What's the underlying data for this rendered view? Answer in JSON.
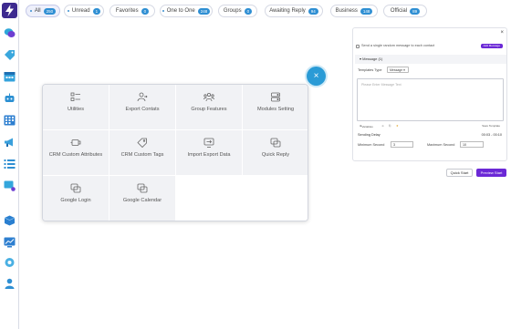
{
  "tabs": [
    {
      "label": "All",
      "badge": "250",
      "dot": true,
      "active": true
    },
    {
      "label": "Unread",
      "badge": "1",
      "dot": true,
      "active": false
    },
    {
      "label": "Favorites",
      "badge": "0",
      "dot": false,
      "active": false
    },
    {
      "label": "One to One",
      "badge": "248",
      "dot": true,
      "active": false
    },
    {
      "label": "Groups",
      "badge": "0",
      "dot": false,
      "active": false
    },
    {
      "label": "Awaiting Reply",
      "badge": "94",
      "dot": false,
      "active": false
    },
    {
      "label": "Business",
      "badge": "148",
      "dot": false,
      "active": false
    },
    {
      "label": "Official",
      "badge": "89",
      "dot": false,
      "active": false
    }
  ],
  "sidebar_icons": [
    "chat-icon",
    "tag-icon",
    "calendar-icon",
    "bot-icon",
    "grid-icon",
    "megaphone-icon",
    "list-icon",
    "media-icon",
    "box-icon",
    "chart-icon",
    "settings-icon",
    "user-icon"
  ],
  "menu": {
    "items": [
      {
        "label": "Utilities",
        "icon": "utilities-icon"
      },
      {
        "label": "Export Contats",
        "icon": "export-contacts-icon"
      },
      {
        "label": "Group Features",
        "icon": "group-features-icon"
      },
      {
        "label": "Modules Setting",
        "icon": "modules-setting-icon"
      },
      {
        "label": "CRM Custom Attributes",
        "icon": "crm-attributes-icon"
      },
      {
        "label": "CRM Custom Tags",
        "icon": "crm-tags-icon"
      },
      {
        "label": "Import Export Data",
        "icon": "import-export-icon"
      },
      {
        "label": "Quick Reply",
        "icon": "quick-reply-icon"
      },
      {
        "label": "Google Login",
        "icon": "google-login-icon"
      },
      {
        "label": "Google Calendar",
        "icon": "google-calendar-icon"
      }
    ],
    "close_symbol": "×"
  },
  "panel": {
    "close_symbol": "×",
    "random_label": "Send a single random message to each contact",
    "add_message_label": "Add Message",
    "message_title": "Message (1)",
    "template_type_label": "Templates Type",
    "template_type_value": "Message",
    "placeholder": "Please Enter Message Text",
    "toolbar": [
      "Variables",
      "Save Template"
    ],
    "sending_delay_label": "Sending Delay",
    "sending_delay_value": "00:03 - 00:10",
    "min_label": "Minimum Second",
    "min_value": "3",
    "max_label": "Maximum Second",
    "max_value": "10"
  },
  "buttons": {
    "quick_start": "Quick Start",
    "preview_start": "Preview Start"
  },
  "colors": {
    "accent_blue": "#2f8fd3",
    "accent_purple": "#6b28d6",
    "rail_logo": "#3d2a8f"
  }
}
